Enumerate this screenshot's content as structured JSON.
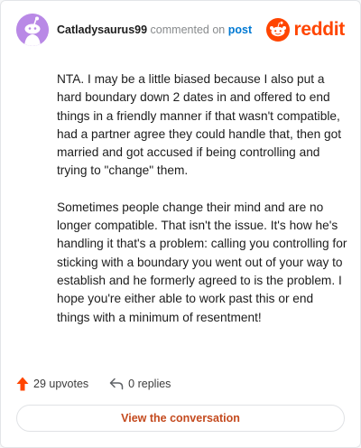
{
  "comment": {
    "author": "Catladysaurus99",
    "action_text": "commented on",
    "target_link": "post",
    "paragraphs": [
      "NTA. I may be a little biased because I also put a hard boundary down 2 dates in and offered to end things in a friendly manner if that wasn't compatible, had a partner agree they could handle that, then got married and got accused if being controlling and trying to \"change\" them.",
      "Sometimes people change their mind and are no longer compatible. That isn't the issue. It's how he's handling it that's a problem: calling you controlling for sticking with a boundary you went out of your way to establish and he formerly agreed to is the problem. I hope you're either able to work past this or end things with a minimum of resentment!"
    ],
    "upvotes": "29 upvotes",
    "replies": "0 replies"
  },
  "brand": {
    "name": "reddit",
    "icon": "reddit-logo-icon",
    "color": "#ff4500"
  },
  "avatar": {
    "icon": "snoo-avatar-icon",
    "color": "#b989e6"
  },
  "actions": {
    "view_conversation": "View the conversation"
  }
}
